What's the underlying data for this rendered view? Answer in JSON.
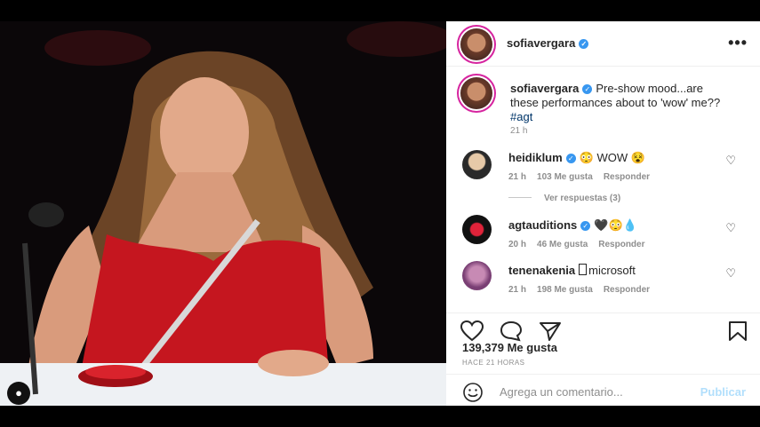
{
  "post": {
    "username": "sofiavergara",
    "more_icon": "more-dots-icon",
    "caption_text": "Pre-show mood...are these performances about to 'wow' me?? ",
    "caption_tag": "#agt",
    "caption_time": "21 h"
  },
  "comments": [
    {
      "user": "heidiklum",
      "text": "😳 WOW 😵",
      "time": "21 h",
      "likes": "103 Me gusta",
      "reply": "Responder",
      "replies": "Ver respuestas (3)"
    },
    {
      "user": "agtauditions",
      "text": "🖤😳💧",
      "time": "20 h",
      "likes": "46 Me gusta",
      "reply": "Responder"
    },
    {
      "user": "tenenakenia",
      "text": "microsoft",
      "time": "21 h",
      "likes": "198 Me gusta",
      "reply": "Responder"
    }
  ],
  "stats": {
    "likes": "139,379 Me gusta",
    "ago": "HACE 21 HORAS"
  },
  "comment_box": {
    "placeholder": "Agrega un comentario...",
    "publish": "Publicar"
  }
}
